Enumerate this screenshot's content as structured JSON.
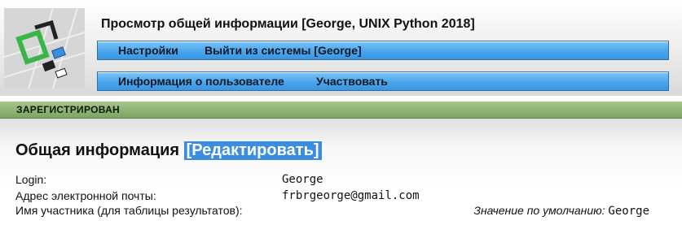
{
  "header": {
    "title": "Просмотр общей информации [George, UNIX Python 2018]"
  },
  "menu_top": {
    "settings": "Настройки",
    "logout": "Выйти из системы [George]"
  },
  "menu_bottom": {
    "user_info": "Информация о пользователе",
    "participate": "Участвовать"
  },
  "status": {
    "text": "ЗАРЕГИСТРИРОВАН"
  },
  "section": {
    "title": "Общая информация",
    "edit_link": "[Редактировать]"
  },
  "fields": {
    "login_label": "Login:",
    "login_value": "George",
    "email_label": "Адрес электронной почты:",
    "email_value": "frbrgeorge@gmail.com",
    "name_label": "Имя участника (для таблицы результатов):",
    "default_label": "Значение по умолчанию:",
    "default_value": "George"
  },
  "colors": {
    "menu_blue": "#4aa6ec",
    "status_green": "#8fb576",
    "edit_highlight": "#3b8de0"
  },
  "icons": {
    "logo": "ejudge-logo-icon"
  }
}
